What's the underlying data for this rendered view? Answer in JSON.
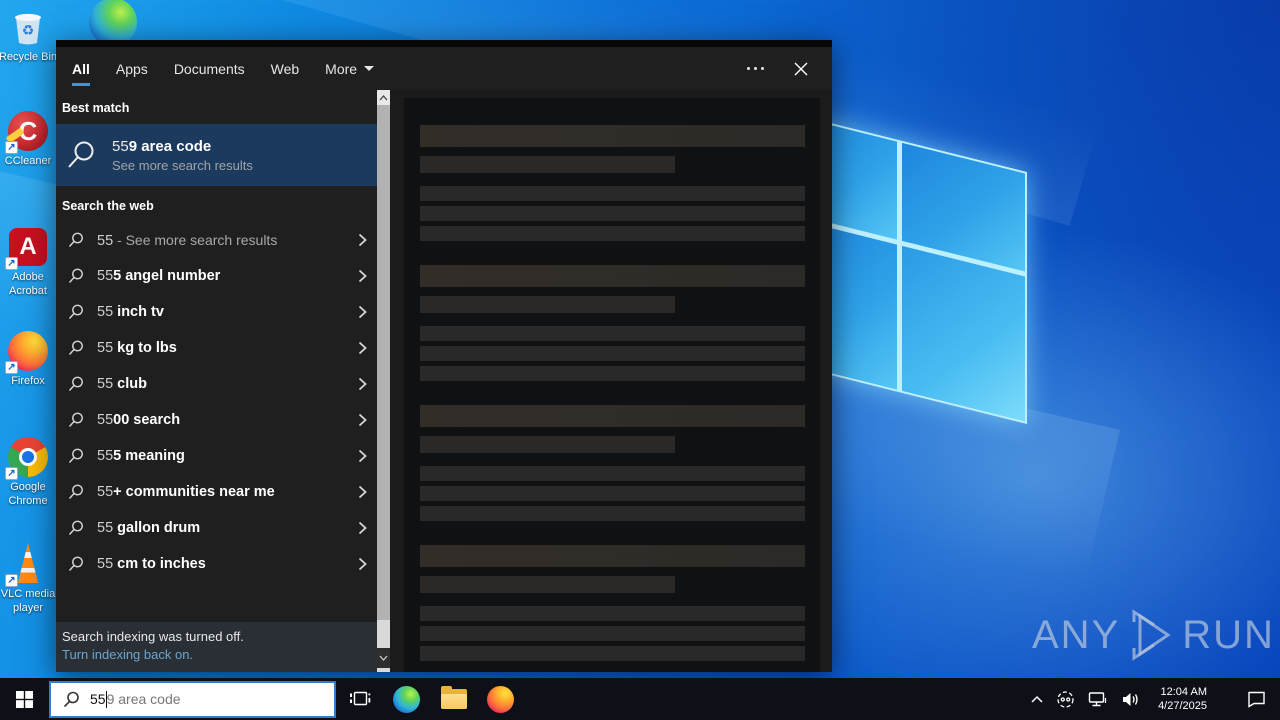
{
  "colors": {
    "accent_underline": "#3a96dd",
    "selection_bg": "#1c3a5e",
    "link": "#6ca6cc",
    "search_border": "#2e7ed3",
    "wallpaper_blue": "#0b62d0"
  },
  "search_panel": {
    "tabs": [
      {
        "label": "All",
        "active": true
      },
      {
        "label": "Apps"
      },
      {
        "label": "Documents"
      },
      {
        "label": "Web"
      },
      {
        "label": "More",
        "dropdown": true
      }
    ],
    "best_match": {
      "header": "Best match",
      "title_typed": "55",
      "title_completion": "9 area code",
      "subtitle": "See more search results"
    },
    "web": {
      "header": "Search the web",
      "items": [
        {
          "typed": "55",
          "completion": " - See more search results",
          "muted": true
        },
        {
          "typed": "55",
          "completion": "5 angel number"
        },
        {
          "typed": "55",
          "completion": " inch tv"
        },
        {
          "typed": "55",
          "completion": " kg to lbs"
        },
        {
          "typed": "55",
          "completion": " club"
        },
        {
          "typed": "55",
          "completion": "00 search"
        },
        {
          "typed": "55",
          "completion": "5 meaning"
        },
        {
          "typed": "55",
          "completion": "+ communities near me"
        },
        {
          "typed": "55",
          "completion": " gallon drum"
        },
        {
          "typed": "55",
          "completion": " cm to inches"
        }
      ]
    },
    "footer": {
      "line1": "Search indexing was turned off.",
      "line2": "Turn indexing back on."
    }
  },
  "taskbar": {
    "search": {
      "typed": "55",
      "suggestion": "9 area code"
    },
    "clock": {
      "time": "12:04 AM",
      "date": "4/27/2025"
    }
  },
  "desktop": {
    "icons": [
      {
        "label": "Recycle Bin"
      },
      {
        "label": "CCleaner"
      },
      {
        "label": "Adobe Acrobat"
      },
      {
        "label": "Firefox"
      },
      {
        "label": "Google Chrome"
      },
      {
        "label": "VLC media player"
      }
    ],
    "ccleaner_letter": "C",
    "acrobat_letter": "A"
  },
  "watermark": {
    "left": "ANY",
    "right": "RUN"
  }
}
